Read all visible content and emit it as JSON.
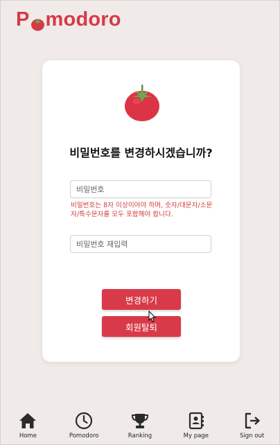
{
  "app": {
    "logo_prefix": "P",
    "logo_suffix": "modoro"
  },
  "dialog": {
    "title": "비밀번호를 변경하시겠습니까?",
    "password_placeholder": "비밀번호",
    "password_error": "비밀번호는 8자 이상이어야 하며, 숫자/대문자/소문자/특수문자를 모두 포함해야 합니다.",
    "confirm_placeholder": "비밀번호 재입력",
    "change_button": "변경하기",
    "withdraw_button": "회원탈퇴"
  },
  "nav": {
    "items": [
      {
        "label": "Home",
        "icon": "home-icon"
      },
      {
        "label": "Pomodoro",
        "icon": "clock-icon"
      },
      {
        "label": "Ranking",
        "icon": "trophy-icon"
      },
      {
        "label": "My page",
        "icon": "contact-book-icon"
      },
      {
        "label": "Sign out",
        "icon": "sign-out-icon"
      }
    ]
  },
  "colors": {
    "accent": "#d93a4a",
    "error": "#d33a3a",
    "background": "#f0ebe8",
    "tomato_leaf": "#6aa84f"
  }
}
